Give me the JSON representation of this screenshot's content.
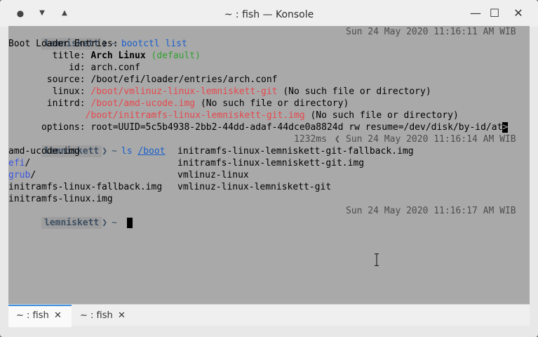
{
  "window": {
    "title": "~ : fish — Konsole",
    "buttons": {
      "menu": "●",
      "collapse": "▼",
      "expand": "▲",
      "minimize": "—",
      "maximize": "☐",
      "close": "✕"
    }
  },
  "prompt": {
    "user": "lemniskett",
    "sep": "❯",
    "dir": "~"
  },
  "block1": {
    "command": "bootctl list",
    "timestamp": "Sun 24 May 2020 11:16:11 AM WIB",
    "heading": "Boot Loader Entries:",
    "title_label": "        title:",
    "title_value": "Arch Linux",
    "title_default": "(default)",
    "id_label": "           id:",
    "id_value": "arch.conf",
    "source_label": "       source:",
    "source_value": "/boot/efi/loader/entries/arch.conf",
    "linux_label": "        linux:",
    "linux_value": "/boot/vmlinuz-linux-lemniskett-git",
    "linux_note": "(No such file or directory)",
    "initrd_label": "       initrd:",
    "initrd_value1": "/boot/amd-ucode.img",
    "initrd_note1": "(No such file or directory)",
    "initrd_value2": "/boot/initramfs-linux-lemniskett-git.img",
    "initrd_note2": "(No such file or directory)",
    "options_label": "      options:",
    "options_value": "root=UUID=5c5b4938-2bb2-44dd-adaf-44dce0a8824d rw resume=/dev/disk/by-id/at",
    "options_more": ">"
  },
  "block2": {
    "command": "ls",
    "arg": "/boot",
    "duration": "1232ms",
    "duration_sep": "❮",
    "timestamp": "Sun 24 May 2020 11:16:14 AM WIB",
    "col1": [
      "amd-ucode.img",
      "efi",
      "grub",
      "initramfs-linux-fallback.img",
      "initramfs-linux.img"
    ],
    "col1_suffix": [
      "",
      "/",
      "/",
      "",
      ""
    ],
    "col2": [
      "initramfs-linux-lemniskett-git-fallback.img",
      "initramfs-linux-lemniskett-git.img",
      "vmlinuz-linux",
      "vmlinuz-linux-lemniskett-git"
    ]
  },
  "block3": {
    "timestamp": "Sun 24 May 2020 11:16:17 AM WIB"
  },
  "tabs": [
    {
      "label": "~ : fish",
      "close": "✕",
      "active": true
    },
    {
      "label": "~ : fish",
      "close": "✕",
      "active": false
    }
  ],
  "colors": {
    "terminal_bg": "#a9a9a9",
    "prompt_fg": "#3d4f62",
    "command_fg": "#1a5fcc",
    "error_fg": "#e8464b",
    "dir_fg": "#3b56e0",
    "default_fg": "#33a032",
    "tab_accent": "#3d8ee0"
  }
}
